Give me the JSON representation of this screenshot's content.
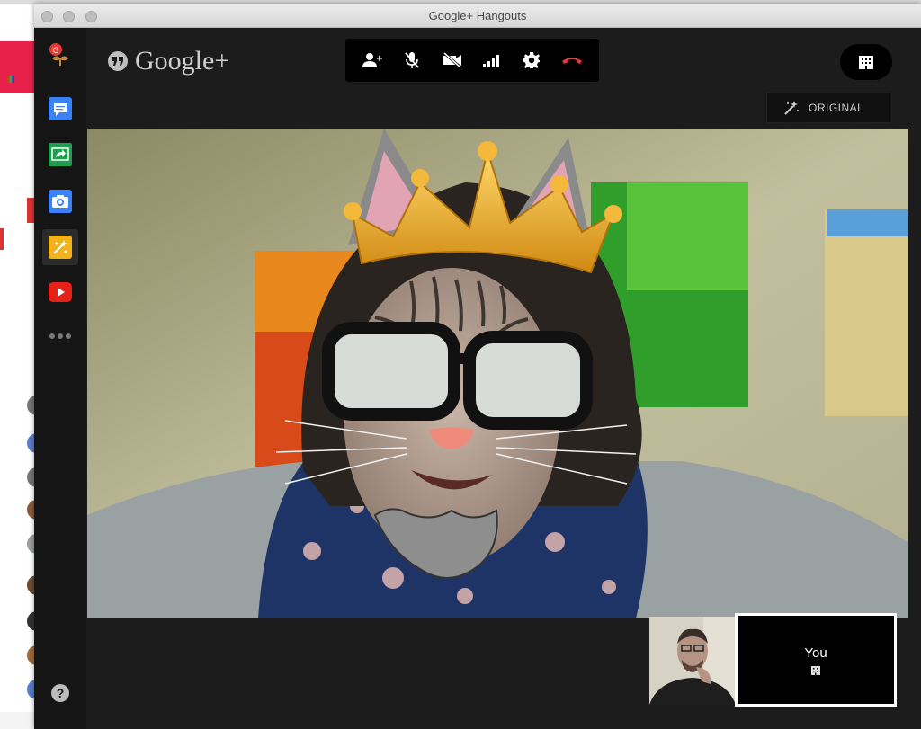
{
  "window": {
    "title": "Google+ Hangouts"
  },
  "brand": {
    "name": "Google+"
  },
  "toolbar": {
    "buttons": [
      "add-person",
      "mute-microphone",
      "turn-off-camera",
      "bandwidth",
      "settings",
      "hang-up"
    ]
  },
  "effects": {
    "original_label": "ORIGINAL"
  },
  "self_view": {
    "label": "You"
  },
  "sidebar": {
    "apps": [
      "hangout-toolbox",
      "chat",
      "screenshare",
      "capture",
      "google-effects",
      "youtube",
      "more"
    ]
  },
  "colors": {
    "hangup": "#e53935",
    "rail_bg": "#151515",
    "window_bg": "#1c1c1c",
    "toolbar_bg": "#000000",
    "chat_blue": "#3b82f6",
    "screenshare_green": "#1e9e4f",
    "effects_yellow": "#f2b21b",
    "youtube_red": "#e62117"
  }
}
